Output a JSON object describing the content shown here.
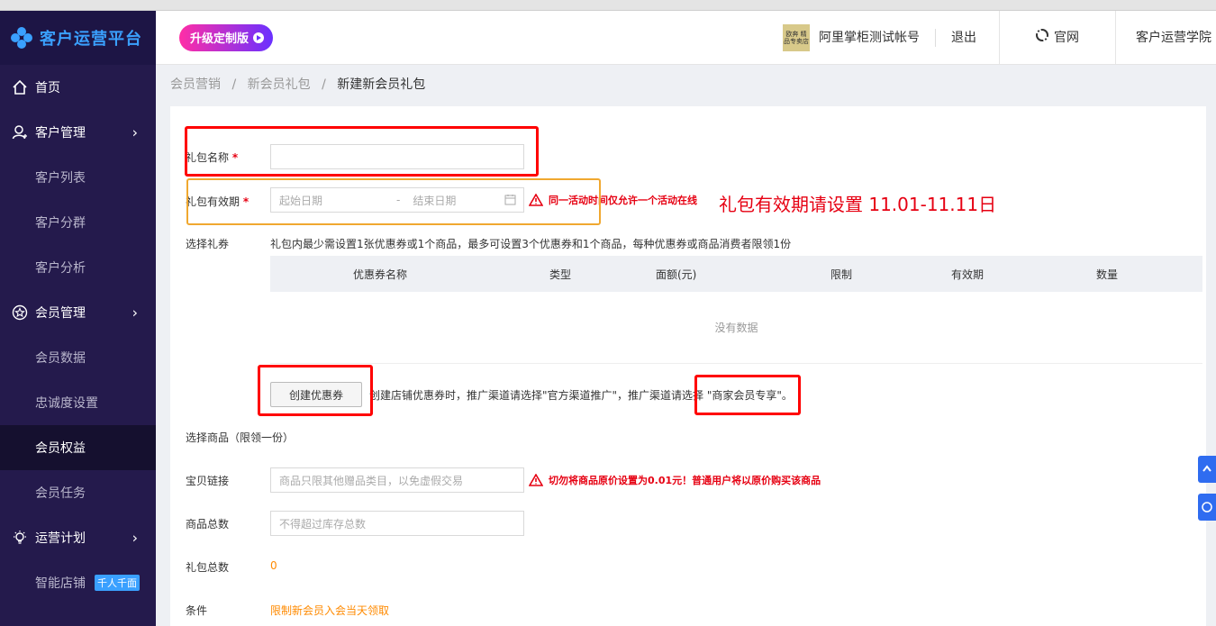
{
  "brand": {
    "title": "客户运营平台"
  },
  "sidebar": {
    "items": [
      {
        "label": "首页",
        "icon": "home-icon"
      },
      {
        "label": "客户管理",
        "icon": "user-icon"
      },
      {
        "label": "客户列表"
      },
      {
        "label": "客户分群"
      },
      {
        "label": "客户分析"
      },
      {
        "label": "会员管理",
        "icon": "star-icon"
      },
      {
        "label": "会员数据"
      },
      {
        "label": "忠诚度设置"
      },
      {
        "label": "会员权益"
      },
      {
        "label": "会员任务"
      },
      {
        "label": "运营计划",
        "icon": "bulb-icon"
      },
      {
        "label": "智能店铺",
        "tag": "千人千面"
      }
    ]
  },
  "header": {
    "upgrade_label": "升级定制版",
    "shop_logo_text": "欧奔 精品专卖店",
    "account": "阿里掌柜测试帐号",
    "logout": "退出",
    "official": "官网",
    "academy": "客户运营学院"
  },
  "breadcrumb": {
    "items": [
      "会员营销",
      "新会员礼包"
    ],
    "separator": "/",
    "current": "新建新会员礼包"
  },
  "form": {
    "name_label": "礼包名称",
    "required_mark": "*",
    "validity_label": "礼包有效期",
    "start_placeholder": "起始日期",
    "range_separator": "-",
    "end_placeholder": "结束日期",
    "validity_warning": "同一活动时间仅允许一个活动在线",
    "validity_note": "礼包有效期请设置 11.01-11.11日",
    "coupon_label": "选择礼券",
    "coupon_rule": "礼包内最少需设置1张优惠券或1个商品，最多可设置3个优惠券和1个商品，每种优惠券或商品消费者限领1份",
    "table_headers": [
      "优惠券名称",
      "类型",
      "面额(元)",
      "限制",
      "有效期",
      "数量"
    ],
    "no_data": "没有数据",
    "create_coupon_button": "创建优惠券",
    "create_hint": "创建店铺优惠券时，推广渠道请选择\"官方渠道推广\"，推广渠道请选择 \"商家会员专享\"。",
    "goods_label": "选择商品（限领一份）",
    "item_link_label": "宝贝链接",
    "item_link_placeholder": "商品只限其他赠品类目，以免虚假交易",
    "item_warning": "切勿将商品原价设置为0.01元！普通用户将以原价购买该商品",
    "goods_total_label": "商品总数",
    "goods_total_placeholder": "不得超过库存总数",
    "package_total_label": "礼包总数",
    "package_total_value": "0",
    "condition_label": "条件",
    "condition_value": "限制新会员入会当天领取"
  },
  "colors": {
    "accent": "#3aa0ff",
    "sidebar": "#241a4c",
    "warning": "#e60012",
    "orange": "#ff8a00",
    "highlight_red": "#ff0000",
    "highlight_orange": "#f0a830"
  }
}
